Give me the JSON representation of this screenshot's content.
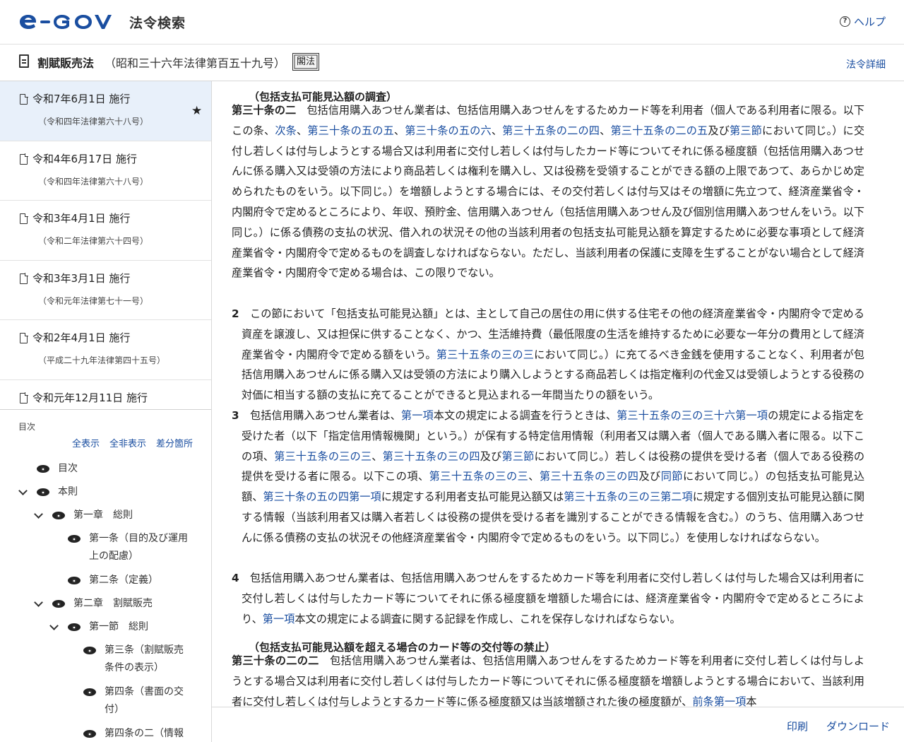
{
  "header": {
    "logo_text": "e-GOV",
    "app_name": "法令検索",
    "help_label": "ヘルプ"
  },
  "law": {
    "title": "割賦販売法",
    "number": "（昭和三十六年法律第百五十九号）",
    "badge": "閣法",
    "detail_link": "法令詳細"
  },
  "versions": [
    {
      "date": "令和7年6月1日 施行",
      "law": "（令和四年法律第六十八号）",
      "active": true
    },
    {
      "date": "令和4年6月17日 施行",
      "law": "（令和四年法律第六十八号）"
    },
    {
      "date": "令和3年4月1日 施行",
      "law": "（令和二年法律第六十四号）"
    },
    {
      "date": "令和3年3月1日 施行",
      "law": "（令和元年法律第七十一号）"
    },
    {
      "date": "令和2年4月1日 施行",
      "law": "（平成二十九年法律第四十五号）"
    },
    {
      "date": "令和元年12月11日 施行",
      "law": ""
    }
  ],
  "toc": {
    "label": "目次",
    "show_all": "全表示",
    "hide_all": "全非表示",
    "diff": "差分箇所",
    "items": [
      {
        "label": "目次"
      },
      {
        "label": "本則"
      },
      {
        "label": "第一章　総則"
      },
      {
        "label": "第一条（目的及び運用上の配慮）",
        "line1": "第一条（目的及び運用",
        "line2": "上の配慮）"
      },
      {
        "label": "第二条（定義）"
      },
      {
        "label": "第二章　割賦販売"
      },
      {
        "label": "第一節　総則"
      },
      {
        "label": "第三条（割賦販売条件の表示）",
        "line1": "第三条（割賦販売",
        "line2": "条件の表示）"
      },
      {
        "label": "第四条（書面の交付）",
        "line1": "第四条（書面の交",
        "line2": "付）"
      },
      {
        "label": "第四条の二（情報",
        "line1": "第四条の二（情報"
      }
    ]
  },
  "content": {
    "art1_caption": "（包括支払可能見込額の調査）",
    "art1_title": "第三十条の二",
    "art1_p1_a": "　包括信用購入あつせん業者は、包括信用購入あつせんをするためカード等を利用者（個人である利用者に限る。以下この条、",
    "art1_p1_l1": "次条",
    "art1_p1_s1": "、",
    "art1_p1_l2": "第三十条の五の五",
    "art1_p1_s2": "、",
    "art1_p1_l3": "第三十条の五の六",
    "art1_p1_s3": "、",
    "art1_p1_l4": "第三十五条の二の四",
    "art1_p1_s4": "、",
    "art1_p1_l5": "第三十五条の二の五",
    "art1_p1_s5": "及び",
    "art1_p1_l6": "第三節",
    "art1_p1_b": "において同じ。）に交付し若しくは付与しようとする場合又は利用者に交付し若しくは付与したカード等についてそれに係る極度額（包括信用購入あつせんに係る購入又は受領の方法により商品若しくは権利を購入し、又は役務を受領することができる額の上限であつて、あらかじめ定められたものをいう。以下同じ。）を増額しようとする場合には、その交付若しくは付与又はその増額に先立つて、経済産業省令・内閣府令で定めるところにより、年収、預貯金、信用購入あつせん（包括信用購入あつせん及び個別信用購入あつせんをいう。以下同じ。）に係る債務の支払の状況、借入れの状況その他の当該利用者の包括支払可能見込額を算定するために必要な事項として経済産業省令・内閣府令で定めるものを調査しなければならない。ただし、当該利用者の保護に支障を生ずることがない場合として経済産業省令・内閣府令で定める場合は、この限りでない。",
    "p2_num": "2",
    "p2_a": "　この節において「包括支払可能見込額」とは、主として自己の居住の用に供する住宅その他の経済産業省令・内閣府令で定める資産を譲渡し、又は担保に供することなく、かつ、生活維持費（最低限度の生活を維持するために必要な一年分の費用として経済産業省令・内閣府令で定める額をいう。",
    "p2_l1": "第三十五条の三の三",
    "p2_b": "において同じ。）に充てるべき金銭を使用することなく、利用者が包括信用購入あつせんに係る購入又は受領の方法により購入しようとする商品若しくは指定権利の代金又は受領しようとする役務の対価に相当する額の支払に充てることができると見込まれる一年間当たりの額をいう。",
    "p3_num": "3",
    "p3_a": "　包括信用購入あつせん業者は、",
    "p3_l1": "第一項",
    "p3_b": "本文の規定による調査を行うときは、",
    "p3_l2": "第三十五条の三の三十六第一項",
    "p3_c": "の規定による指定を受けた者（以下「指定信用情報機関」という。）が保有する特定信用情報（利用者又は購入者（個人である購入者に限る。以下この項、",
    "p3_l3": "第三十五条の三の三",
    "p3_d": "、",
    "p3_l4": "第三十五条の三の四",
    "p3_e": "及び",
    "p3_l5": "第三節",
    "p3_f": "において同じ。）若しくは役務の提供を受ける者（個人である役務の提供を受ける者に限る。以下この項、",
    "p3_l6": "第三十五条の三の三",
    "p3_g": "、",
    "p3_l7": "第三十五条の三の四",
    "p3_h": "及び",
    "p3_l8": "同節",
    "p3_i": "において同じ。）の包括支払可能見込額、",
    "p3_l9": "第三十条の五の四第一項",
    "p3_j": "に規定する利用者支払可能見込額又は",
    "p3_l10": "第三十五条の三の三第二項",
    "p3_k": "に規定する個別支払可能見込額に関する情報（当該利用者又は購入者若しくは役務の提供を受ける者を識別することができる情報を含む。）のうち、信用購入あつせんに係る債務の支払の状況その他経済産業省令・内閣府令で定めるものをいう。以下同じ。）を使用しなければならない。",
    "p4_num": "4",
    "p4_a": "　包括信用購入あつせん業者は、包括信用購入あつせんをするためカード等を利用者に交付し若しくは付与した場合又は利用者に交付し若しくは付与したカード等についてそれに係る極度額を増額した場合には、経済産業省令・内閣府令で定めるところにより、",
    "p4_l1": "第一項",
    "p4_b": "本文の規定による調査に関する記録を作成し、これを保存しなければならない。",
    "art2_caption": "（包括支払可能見込額を超える場合のカード等の交付等の禁止）",
    "art2_title": "第三十条の二の二",
    "art2_a": "　包括信用購入あつせん業者は、包括信用購入あつせんをするためカード等を利用者に交付し若しくは付与しようとする場合又は利用者に交付し若しくは付与したカード等についてそれに係る極度額を増額しようとする場合において、当該利用者に交付し若しくは付与しようとするカード等に係る極度額又は当該増額された後の極度額が、",
    "art2_l1": "前条第一項",
    "art2_b": "本"
  },
  "footer": {
    "print": "印刷",
    "download": "ダウンロード"
  },
  "colors": {
    "link": "#1a4ea0",
    "logo_blue": "#1a4ea0",
    "active_version_bg": "#e8f0fa"
  }
}
